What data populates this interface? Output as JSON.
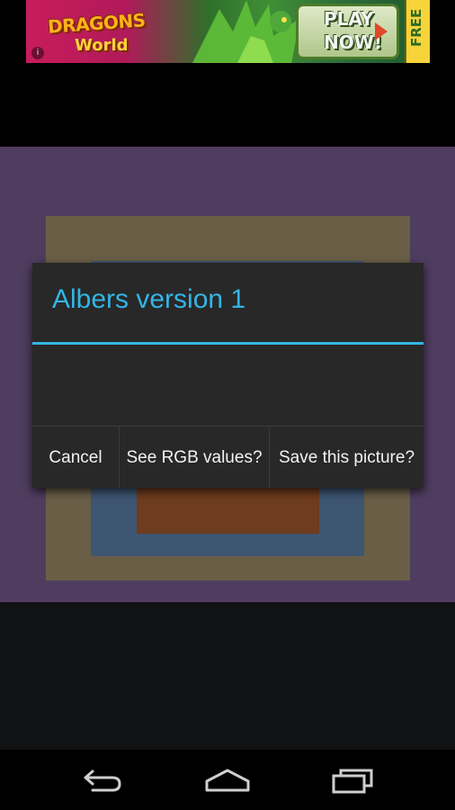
{
  "ad": {
    "logo_line1": "DRAGONS",
    "logo_line2": "World",
    "cta_line1": "PLAY",
    "cta_line2": "NOW!",
    "free_label": "FREE",
    "info_icon": "info-icon"
  },
  "artwork": {
    "colors": {
      "outer": "#4f3d60",
      "band2": "#6a5e47",
      "band3": "#3e5672",
      "band4": "#6e3c1e"
    }
  },
  "dialog": {
    "title": "Albers version 1",
    "buttons": {
      "cancel": "Cancel",
      "rgb": "See RGB values?",
      "save": "Save this picture?"
    },
    "accent_color": "#33b5e5"
  },
  "navbar": {
    "back_icon": "back-icon",
    "home_icon": "home-icon",
    "recents_icon": "recents-icon"
  }
}
